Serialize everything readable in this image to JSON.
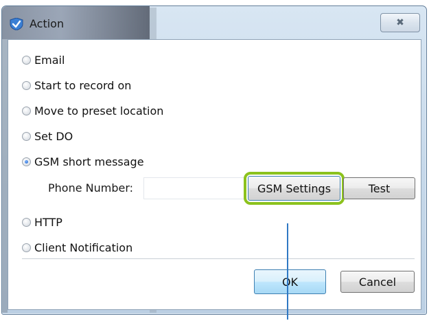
{
  "window": {
    "title": "Action",
    "close_glyph": "✖"
  },
  "options": [
    {
      "label": "Email",
      "checked": false
    },
    {
      "label": "Start to record on",
      "checked": false
    },
    {
      "label": "Move to preset location",
      "checked": false
    },
    {
      "label": "Set DO",
      "checked": false
    },
    {
      "label": "GSM short message",
      "checked": true
    },
    {
      "label": "HTTP",
      "checked": false
    },
    {
      "label": "Client Notification",
      "checked": false
    }
  ],
  "gsm": {
    "phone_label": "Phone Number:",
    "phone_value": "",
    "settings_button": "GSM Settings",
    "test_button": "Test"
  },
  "footer": {
    "ok_label": "OK",
    "cancel_label": "Cancel"
  },
  "colors": {
    "highlight": "#8cc21d",
    "pointer_line": "#2f78c4"
  },
  "icons": {
    "app": "check-shield-icon",
    "close": "close-icon"
  }
}
